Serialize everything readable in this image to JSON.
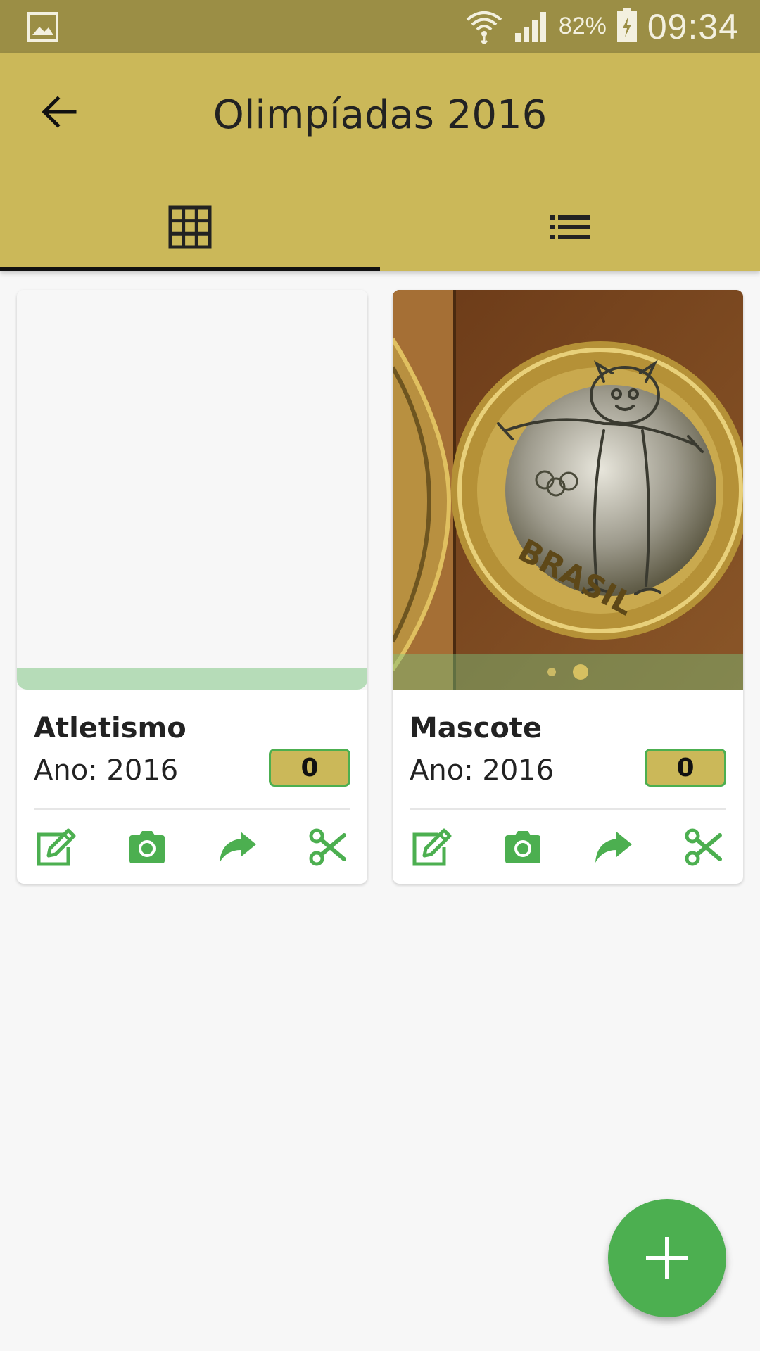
{
  "status_bar": {
    "battery_percent": "82%",
    "time": "09:34",
    "icons": [
      "gallery-icon",
      "wifi-icon",
      "signal-icon",
      "battery-charging-icon"
    ]
  },
  "app_bar": {
    "title": "Olimpíadas 2016",
    "back_icon": "arrow-left-icon",
    "tabs": [
      {
        "icon": "grid-icon",
        "selected": true
      },
      {
        "icon": "list-icon",
        "selected": false
      }
    ]
  },
  "cards": [
    {
      "name": "Atletismo",
      "year": "Ano: 2016",
      "count": "0",
      "actions": [
        "edit-icon",
        "camera-icon",
        "share-icon",
        "scissors-icon"
      ]
    },
    {
      "name": "Mascote",
      "year": "Ano: 2016",
      "count": "0",
      "image_text": "BRASIL",
      "carousel": {
        "page": 2,
        "pages": 2
      },
      "actions": [
        "edit-icon",
        "camera-icon",
        "share-icon",
        "scissors-icon"
      ]
    }
  ],
  "fab": {
    "icon": "plus-icon"
  },
  "colors": {
    "status_bar": "#9b8e45",
    "app_bar": "#cbb859",
    "accent_green": "#4caf50",
    "background": "#f7f7f7"
  }
}
